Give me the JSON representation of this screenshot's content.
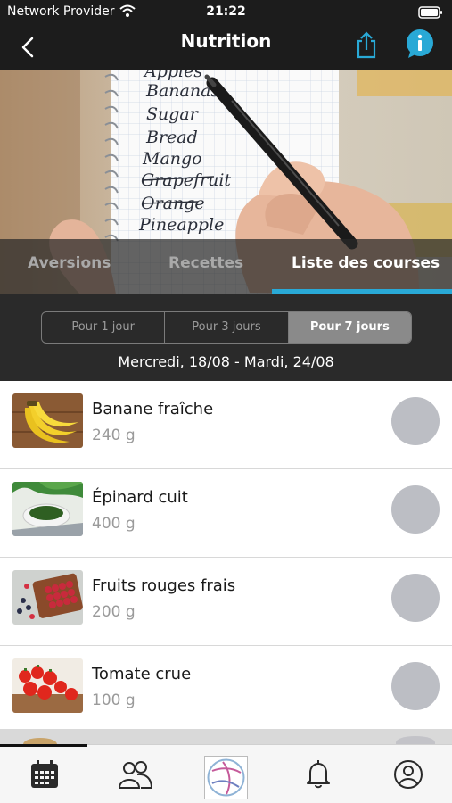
{
  "status_bar": {
    "carrier": "Network Provider",
    "time": "21:22"
  },
  "header": {
    "title": "Nutrition"
  },
  "hero": {
    "note_lines": [
      "Apples",
      "Bananas",
      "Sugar",
      "Bread",
      "Mango",
      "Grapefruit",
      "Orange",
      "Pineapple"
    ],
    "tabs": [
      {
        "label": "Aversions",
        "active": false
      },
      {
        "label": "Recettes",
        "active": false
      },
      {
        "label": "Liste des courses",
        "active": true
      }
    ]
  },
  "period": {
    "options": [
      "Pour 1 jour",
      "Pour 3 jours",
      "Pour 7 jours"
    ],
    "selected_index": 2,
    "date_range": "Mercredi, 18/08 - Mardi, 24/08"
  },
  "items": [
    {
      "name": "Banane fraîche",
      "quantity": "240 g",
      "image": "bananas"
    },
    {
      "name": "Épinard cuit",
      "quantity": "400 g",
      "image": "spinach"
    },
    {
      "name": "Fruits rouges frais",
      "quantity": "200 g",
      "image": "berries"
    },
    {
      "name": "Tomate crue",
      "quantity": "100 g",
      "image": "tomatoes"
    }
  ],
  "tab_bar": {
    "items": [
      "calendar-icon",
      "community-icon",
      "app-logo",
      "bell-icon",
      "profile-icon"
    ]
  },
  "colors": {
    "accent": "#29a9d6",
    "header_bg": "#1c1c1c",
    "check_circle": "#bcbec4"
  }
}
